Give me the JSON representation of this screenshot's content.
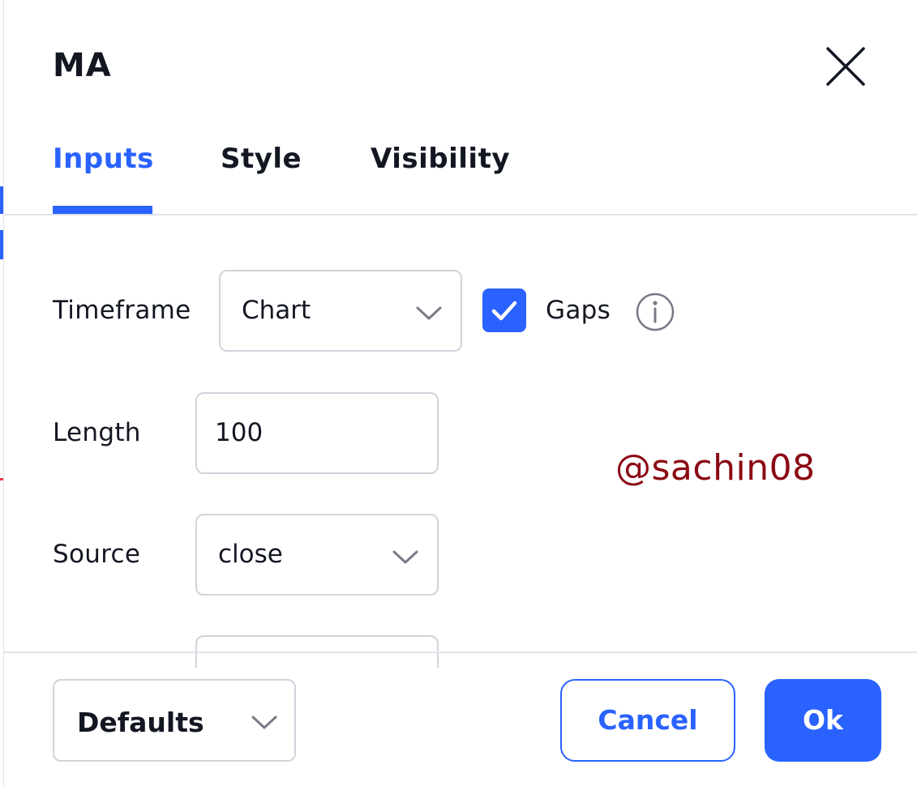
{
  "dialog": {
    "title": "MA"
  },
  "tabs": [
    {
      "label": "Inputs",
      "active": true
    },
    {
      "label": "Style",
      "active": false
    },
    {
      "label": "Visibility",
      "active": false
    }
  ],
  "inputs": {
    "timeframe": {
      "label": "Timeframe",
      "value": "Chart"
    },
    "gaps": {
      "label": "Gaps",
      "checked": true
    },
    "length": {
      "label": "Length",
      "value": "100"
    },
    "source": {
      "label": "Source",
      "value": "close"
    }
  },
  "watermark": "@sachin08",
  "footer": {
    "defaults_label": "Defaults",
    "cancel_label": "Cancel",
    "ok_label": "Ok"
  },
  "colors": {
    "accent": "#2962ff",
    "border": "#d1d4dc",
    "text": "#131722",
    "watermark": "#8b0a14"
  },
  "icons": [
    "close-icon",
    "chevron-down-icon",
    "checkmark-icon",
    "info-icon"
  ]
}
